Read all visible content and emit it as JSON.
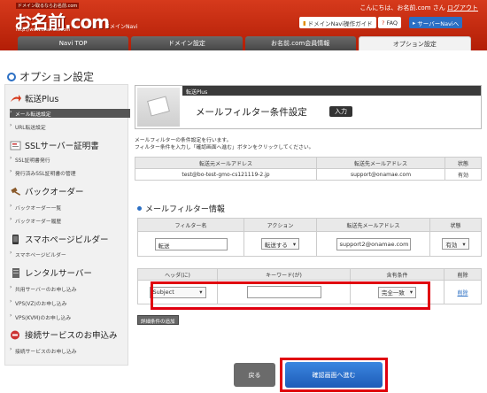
{
  "header": {
    "logo_tagline": "ドメイン取るならお名前.com",
    "logo": "お名前.com",
    "logo_url": "http://www.onamae.com",
    "brand": "ドメインNavi",
    "greeting": "こんにちは、お名前.com さん",
    "logout": "ログアウト",
    "buttons": [
      "ドメインNavi操作ガイド",
      "FAQ",
      "サーバーNaviへ"
    ],
    "tabs": [
      "Navi TOP",
      "ドメイン設定",
      "お名前.com会員情報",
      "オプション設定"
    ],
    "active_tab": 3
  },
  "page_title": "オプション設定",
  "sidebar": {
    "sections": [
      {
        "title": "転送Plus",
        "items": [
          "メール転送設定",
          "URL転送設定"
        ]
      },
      {
        "title": "SSLサーバー証明書",
        "items": [
          "SSL証明書発行",
          "発行済みSSL証明書の管理"
        ]
      },
      {
        "title": "バックオーダー",
        "items": [
          "バックオーダー一覧",
          "バックオーダー履歴"
        ]
      },
      {
        "title": "スマホページビルダー",
        "items": [
          "スマホページビルダー"
        ]
      },
      {
        "title": "レンタルサーバー",
        "items": [
          "共用サーバーのお申し込み",
          "VPS(VZ)のお申し込み",
          "VPS(KVM)のお申し込み"
        ]
      },
      {
        "title": "接続サービスのお申込み",
        "items": [
          "接続サービスのお申し込み"
        ]
      }
    ]
  },
  "banner": {
    "bar": "転送Plus",
    "title": "メールフィルター条件設定",
    "badge": "入力"
  },
  "description": [
    "メールフィルターの条件設定を行います。",
    "フィルター条件を入力し「確認画面へ進む」ボタンをクリックしてください。"
  ],
  "table1": {
    "headers": [
      "転送元メールアドレス",
      "転送先メールアドレス",
      "状態"
    ],
    "row": [
      "test@bo-test-gmo-cs121119-2.jp",
      "support@onamae.com",
      "有効"
    ]
  },
  "filter_info": {
    "title": "メールフィルター情報",
    "headers": [
      "フィルター名",
      "アクション",
      "転送先メールアドレス",
      "状態"
    ],
    "name": "転送",
    "action": "転送する",
    "forward_to": "support2@onamae.com",
    "status": "有効"
  },
  "conditions": {
    "headers": [
      "ヘッダ(に)",
      "キーワード(が)",
      "含有条件",
      "削除"
    ],
    "header_value": "Subject",
    "keyword": "",
    "match": "完全一致",
    "delete": "削除"
  },
  "add_condition_button": "詳細条件の追加",
  "buttons": {
    "back": "戻る",
    "confirm": "確認画面へ進む"
  }
}
